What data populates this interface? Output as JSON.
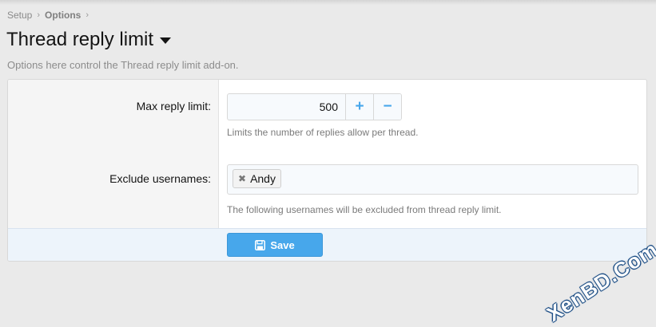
{
  "breadcrumb": {
    "items": [
      "Setup",
      "Options"
    ]
  },
  "page": {
    "title": "Thread reply limit",
    "description": "Options here control the Thread reply limit add-on."
  },
  "form": {
    "max_reply": {
      "label": "Max reply limit:",
      "value": "500",
      "increment": "+",
      "decrement": "−",
      "hint": "Limits the number of replies allow per thread."
    },
    "exclude": {
      "label": "Exclude usernames:",
      "tag_remove": "✖",
      "tags": [
        "Andy"
      ],
      "hint": "The following usernames will be excluded from thread reply limit."
    },
    "save_label": "Save"
  },
  "watermark": "XenBD.Com",
  "colors": {
    "accent": "#47a7eb",
    "footer": "#edf4fb"
  }
}
